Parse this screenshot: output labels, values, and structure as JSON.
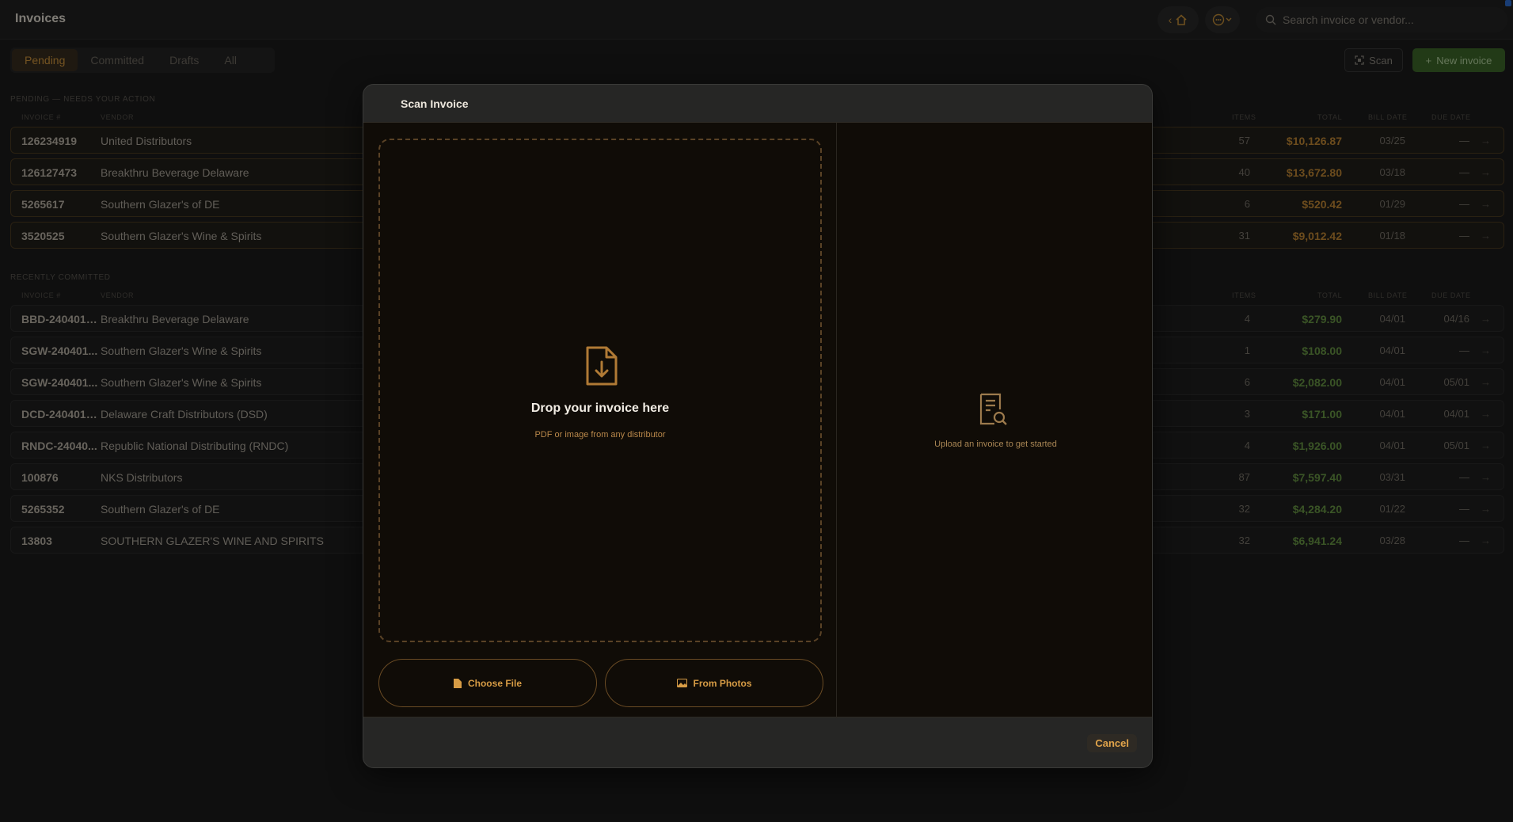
{
  "app": {
    "title": "Invoices"
  },
  "search": {
    "placeholder": "Search invoice or vendor..."
  },
  "tabs": [
    {
      "label": "Pending"
    },
    {
      "label": "Committed"
    },
    {
      "label": "Drafts"
    },
    {
      "label": "All"
    }
  ],
  "toolbar": {
    "scan_label": "Scan",
    "new_label": "New invoice"
  },
  "pending": {
    "section_label": "PENDING — NEEDS YOUR ACTION",
    "columns": {
      "invoice": "INVOICE #",
      "vendor": "VENDOR",
      "items": "ITEMS",
      "total": "TOTAL",
      "bill_date": "BILL DATE",
      "due_date": "DUE DATE"
    },
    "rows": [
      {
        "invoice": "126234919",
        "vendor": "United Distributors",
        "items": "57",
        "total": "$10,126.87",
        "bill": "03/25",
        "due": "—"
      },
      {
        "invoice": "126127473",
        "vendor": "Breakthru Beverage Delaware",
        "items": "40",
        "total": "$13,672.80",
        "bill": "03/18",
        "due": "—"
      },
      {
        "invoice": "5265617",
        "vendor": "Southern Glazer's of DE",
        "items": "6",
        "total": "$520.42",
        "bill": "01/29",
        "due": "—"
      },
      {
        "invoice": "3520525",
        "vendor": "Southern Glazer's Wine & Spirits",
        "items": "31",
        "total": "$9,012.42",
        "bill": "01/18",
        "due": "—"
      }
    ]
  },
  "committed": {
    "section_label": "RECENTLY COMMITTED",
    "columns": {
      "invoice": "INVOICE #",
      "vendor": "VENDOR",
      "items": "ITEMS",
      "total": "TOTAL",
      "bill_date": "BILL DATE",
      "due_date": "DUE DATE"
    },
    "rows": [
      {
        "invoice": "BBD-240401-...",
        "vendor": "Breakthru Beverage Delaware",
        "items": "4",
        "total": "$279.90",
        "bill": "04/01",
        "due": "04/16"
      },
      {
        "invoice": "SGW-240401...",
        "vendor": "Southern Glazer's Wine & Spirits",
        "items": "1",
        "total": "$108.00",
        "bill": "04/01",
        "due": "—"
      },
      {
        "invoice": "SGW-240401...",
        "vendor": "Southern Glazer's Wine & Spirits",
        "items": "6",
        "total": "$2,082.00",
        "bill": "04/01",
        "due": "05/01"
      },
      {
        "invoice": "DCD-240401-...",
        "vendor": "Delaware Craft Distributors (DSD)",
        "items": "3",
        "total": "$171.00",
        "bill": "04/01",
        "due": "04/01"
      },
      {
        "invoice": "RNDC-24040...",
        "vendor": "Republic National Distributing (RNDC)",
        "items": "4",
        "total": "$1,926.00",
        "bill": "04/01",
        "due": "05/01"
      },
      {
        "invoice": "100876",
        "vendor": "NKS Distributors",
        "items": "87",
        "total": "$7,597.40",
        "bill": "03/31",
        "due": "—"
      },
      {
        "invoice": "5265352",
        "vendor": "Southern Glazer's of DE",
        "items": "32",
        "total": "$4,284.20",
        "bill": "01/22",
        "due": "—"
      },
      {
        "invoice": "13803",
        "vendor": "SOUTHERN GLAZER'S WINE AND SPIRITS",
        "items": "32",
        "total": "$6,941.24",
        "bill": "03/28",
        "due": "—"
      }
    ]
  },
  "modal": {
    "title": "Scan Invoice",
    "drop_title": "Drop your invoice here",
    "drop_subtitle": "PDF or image from any distributor",
    "choose_file": "Choose File",
    "from_photos": "From Photos",
    "right_hint": "Upload an invoice to get started",
    "cancel": "Cancel"
  },
  "colors": {
    "accent": "#d59a3e",
    "pending_total": "#c58a36",
    "committed_total": "#6a9a45",
    "primary_button": "#3f6a2b"
  },
  "icons": {
    "nav_back": "chevron-left-icon",
    "home": "home-icon",
    "more": "ellipsis-circle-icon",
    "search": "search-icon",
    "scan": "scan-icon",
    "drop": "file-download-icon",
    "doc": "document-search-icon"
  }
}
